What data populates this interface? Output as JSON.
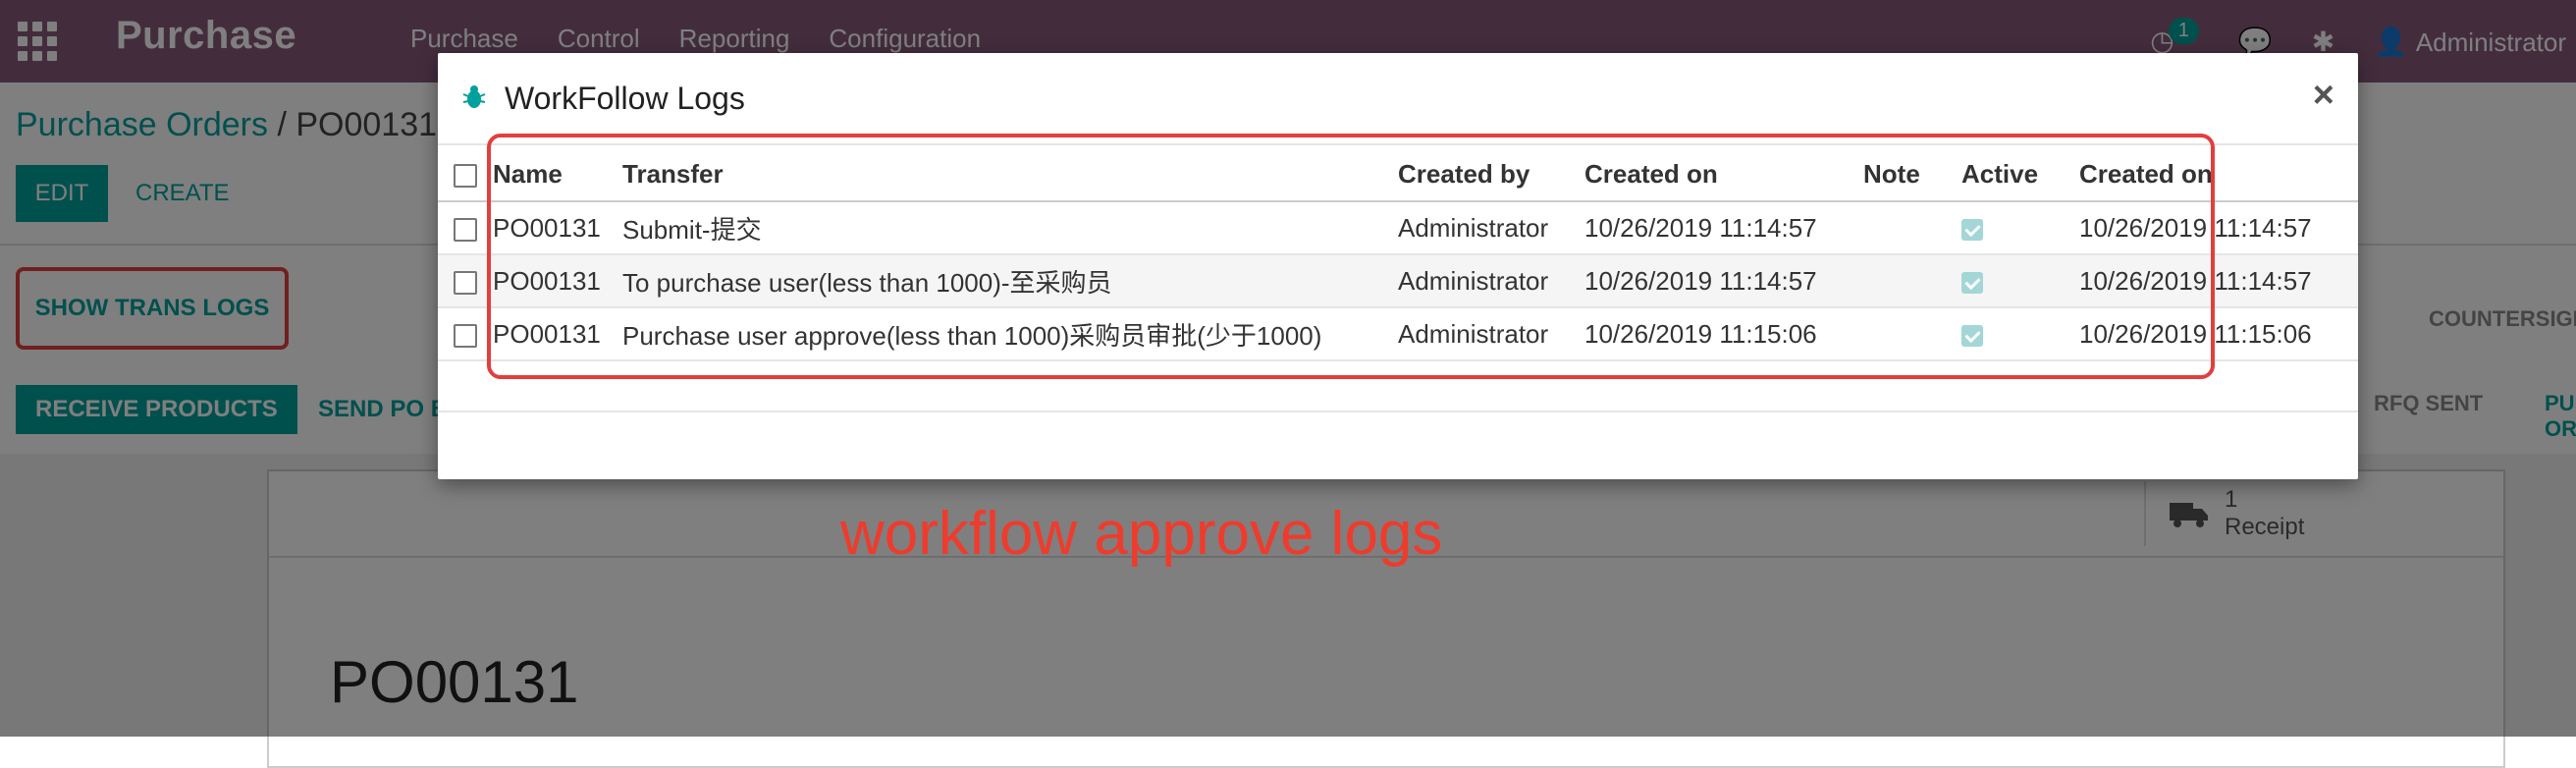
{
  "topbar": {
    "app_name": "Purchase",
    "menu": [
      "Purchase",
      "Control",
      "Reporting",
      "Configuration"
    ],
    "activity_count": "1",
    "user": "Administrator"
  },
  "control_panel": {
    "breadcrumb_root": "Purchase Orders",
    "breadcrumb_sep": "/",
    "breadcrumb_current": "PO00131",
    "edit_label": "EDIT",
    "create_label": "CREATE"
  },
  "show_logs_label": "SHOW TRANS LOGS",
  "statusbar": {
    "receive_label": "RECEIVE PRODUCTS",
    "send_po_label": "SEND PO BY EMAIL",
    "stages": [
      "RFQ SENT",
      "PURCHASE ORDER"
    ],
    "countersign_label": "COUNTERSIGN"
  },
  "sheet": {
    "receipt_count": "1",
    "receipt_label": "Receipt",
    "po_name": "PO00131"
  },
  "modal": {
    "title": "WorkFollow Logs",
    "close": "×",
    "columns": [
      "Name",
      "Transfer",
      "Created by",
      "Created on",
      "Note",
      "Active",
      "Created on"
    ],
    "rows": [
      {
        "name": "PO00131",
        "transfer": "Submit-提交",
        "created_by": "Administrator",
        "created_on": "10/26/2019 11:14:57",
        "note": "",
        "active": true,
        "created_on_2": "10/26/2019 11:14:57"
      },
      {
        "name": "PO00131",
        "transfer": "To purchase user(less than 1000)-至采购员",
        "created_by": "Administrator",
        "created_on": "10/26/2019 11:14:57",
        "note": "",
        "active": true,
        "created_on_2": "10/26/2019 11:14:57"
      },
      {
        "name": "PO00131",
        "transfer": "Purchase user approve(less than 1000)采购员审批(少于1000)",
        "created_by": "Administrator",
        "created_on": "10/26/2019 11:15:06",
        "note": "",
        "active": true,
        "created_on_2": "10/26/2019 11:15:06"
      }
    ]
  },
  "annotation": "workflow approve logs",
  "colors": {
    "topbar": "#875a7b",
    "accent": "#00a09d",
    "highlight": "#e33e3e",
    "annotation": "#ef3b2c"
  }
}
